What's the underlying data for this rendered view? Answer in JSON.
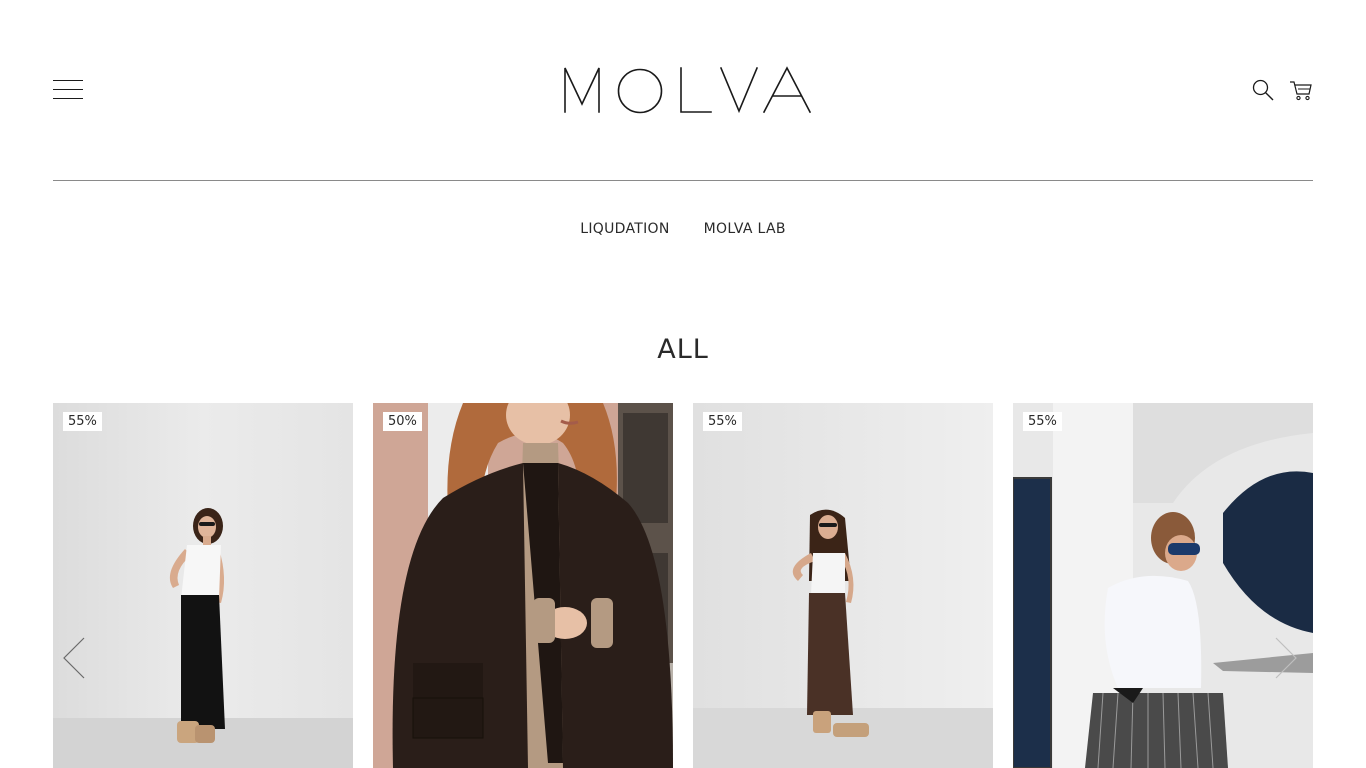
{
  "header": {
    "brand": "MOLVA",
    "menu_icon": "hamburger-menu-icon",
    "search_icon": "search-icon",
    "cart_icon": "cart-icon"
  },
  "subnav": {
    "items": [
      {
        "label": "LIQUDATION"
      },
      {
        "label": "MOLVA LAB"
      }
    ]
  },
  "section": {
    "title": "ALL"
  },
  "products": [
    {
      "badge": "55%",
      "image": "woman in white tank top and black maxi skirt"
    },
    {
      "badge": "50%",
      "image": "woman in dark brown oversized coat"
    },
    {
      "badge": "55%",
      "image": "woman in white top and brown maxi skirt"
    },
    {
      "badge": "55%",
      "image": "woman in white shirt and striped skirt with sunglasses"
    }
  ],
  "carousel": {
    "prev_icon": "chevron-left-icon",
    "next_icon": "chevron-right-icon"
  },
  "colors": {
    "text": "#2a2a2a",
    "divider": "#8a8a8a",
    "background": "#ffffff"
  }
}
